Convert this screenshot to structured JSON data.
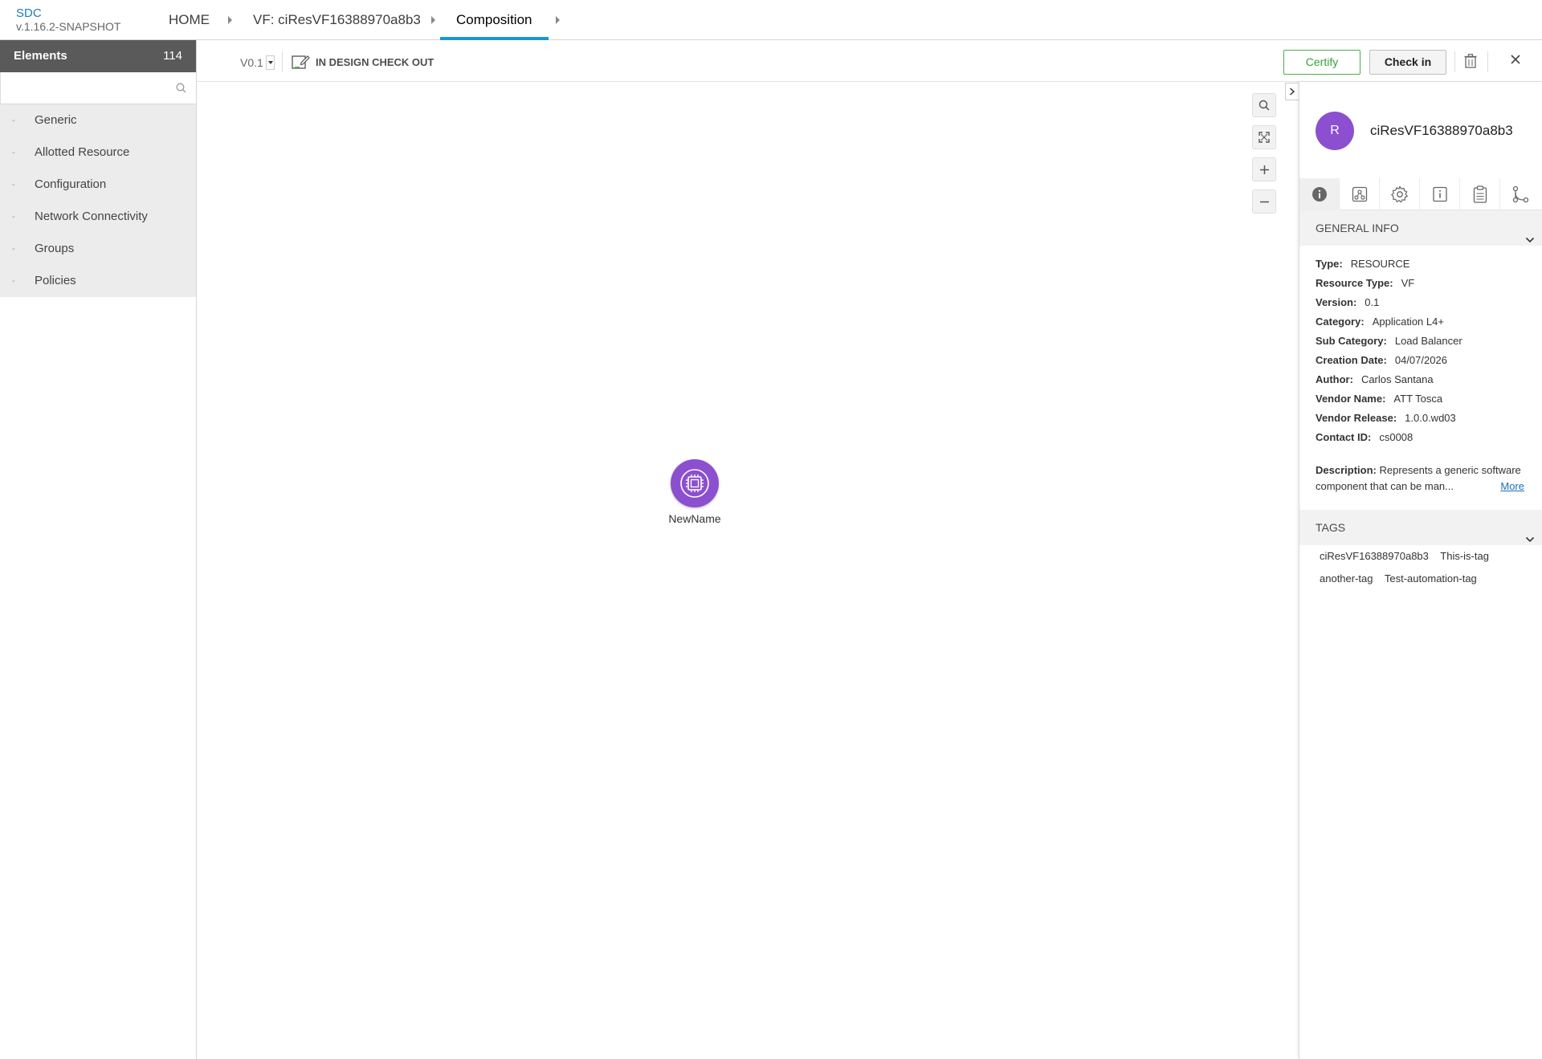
{
  "app": {
    "name": "SDC",
    "version": "v.1.16.2-SNAPSHOT"
  },
  "breadcrumbs": [
    {
      "label": "HOME"
    },
    {
      "label": "VF: ciResVF16388970a8b3"
    },
    {
      "label": "Composition"
    }
  ],
  "palette": {
    "title": "Elements",
    "count": "114",
    "search_placeholder": "",
    "categories": [
      {
        "label": "Generic"
      },
      {
        "label": "Allotted Resource"
      },
      {
        "label": "Configuration"
      },
      {
        "label": "Network Connectivity"
      },
      {
        "label": "Groups"
      },
      {
        "label": "Policies"
      }
    ]
  },
  "toolbar": {
    "version": "V0.1",
    "status": "IN DESIGN CHECK OUT",
    "certify_label": "Certify",
    "checkin_label": "Check in"
  },
  "canvas": {
    "node_label": "NewName"
  },
  "details": {
    "avatar_letter": "R",
    "title": "ciResVF16388970a8b3",
    "general_info_heading": "GENERAL INFO",
    "fields": [
      {
        "key": "Type:",
        "value": "RESOURCE"
      },
      {
        "key": "Resource Type:",
        "value": "VF"
      },
      {
        "key": "Version:",
        "value": "0.1"
      },
      {
        "key": "Category:",
        "value": "Application L4+"
      },
      {
        "key": "Sub Category:",
        "value": "Load Balancer"
      },
      {
        "key": "Creation Date:",
        "value": "04/07/2026"
      },
      {
        "key": "Author:",
        "value": "Carlos Santana"
      },
      {
        "key": "Vendor Name:",
        "value": "ATT Tosca"
      },
      {
        "key": "Vendor Release:",
        "value": "1.0.0.wd03"
      },
      {
        "key": "Contact ID:",
        "value": "cs0008"
      }
    ],
    "description_key": "Description:",
    "description_value": "Represents a generic software component that can be man...",
    "more_label": "More",
    "tags_heading": "TAGS",
    "tags": [
      "ciResVF16388970a8b3",
      "This-is-tag",
      "another-tag",
      "Test-automation-tag"
    ]
  },
  "colors": {
    "accent": "#1b95d4",
    "node": "#8c4fd0",
    "certify": "#36a136"
  },
  "icons": {
    "search": "search-icon",
    "zoom_fit": "fit-screen-icon",
    "zoom_in": "plus-icon",
    "zoom_out": "minus-icon",
    "trash": "trash-icon",
    "close": "close-icon",
    "node": "chip-icon",
    "tabs": [
      "info-icon",
      "composition-icon",
      "settings-icon",
      "properties-icon",
      "clipboard-icon",
      "relations-icon"
    ]
  }
}
